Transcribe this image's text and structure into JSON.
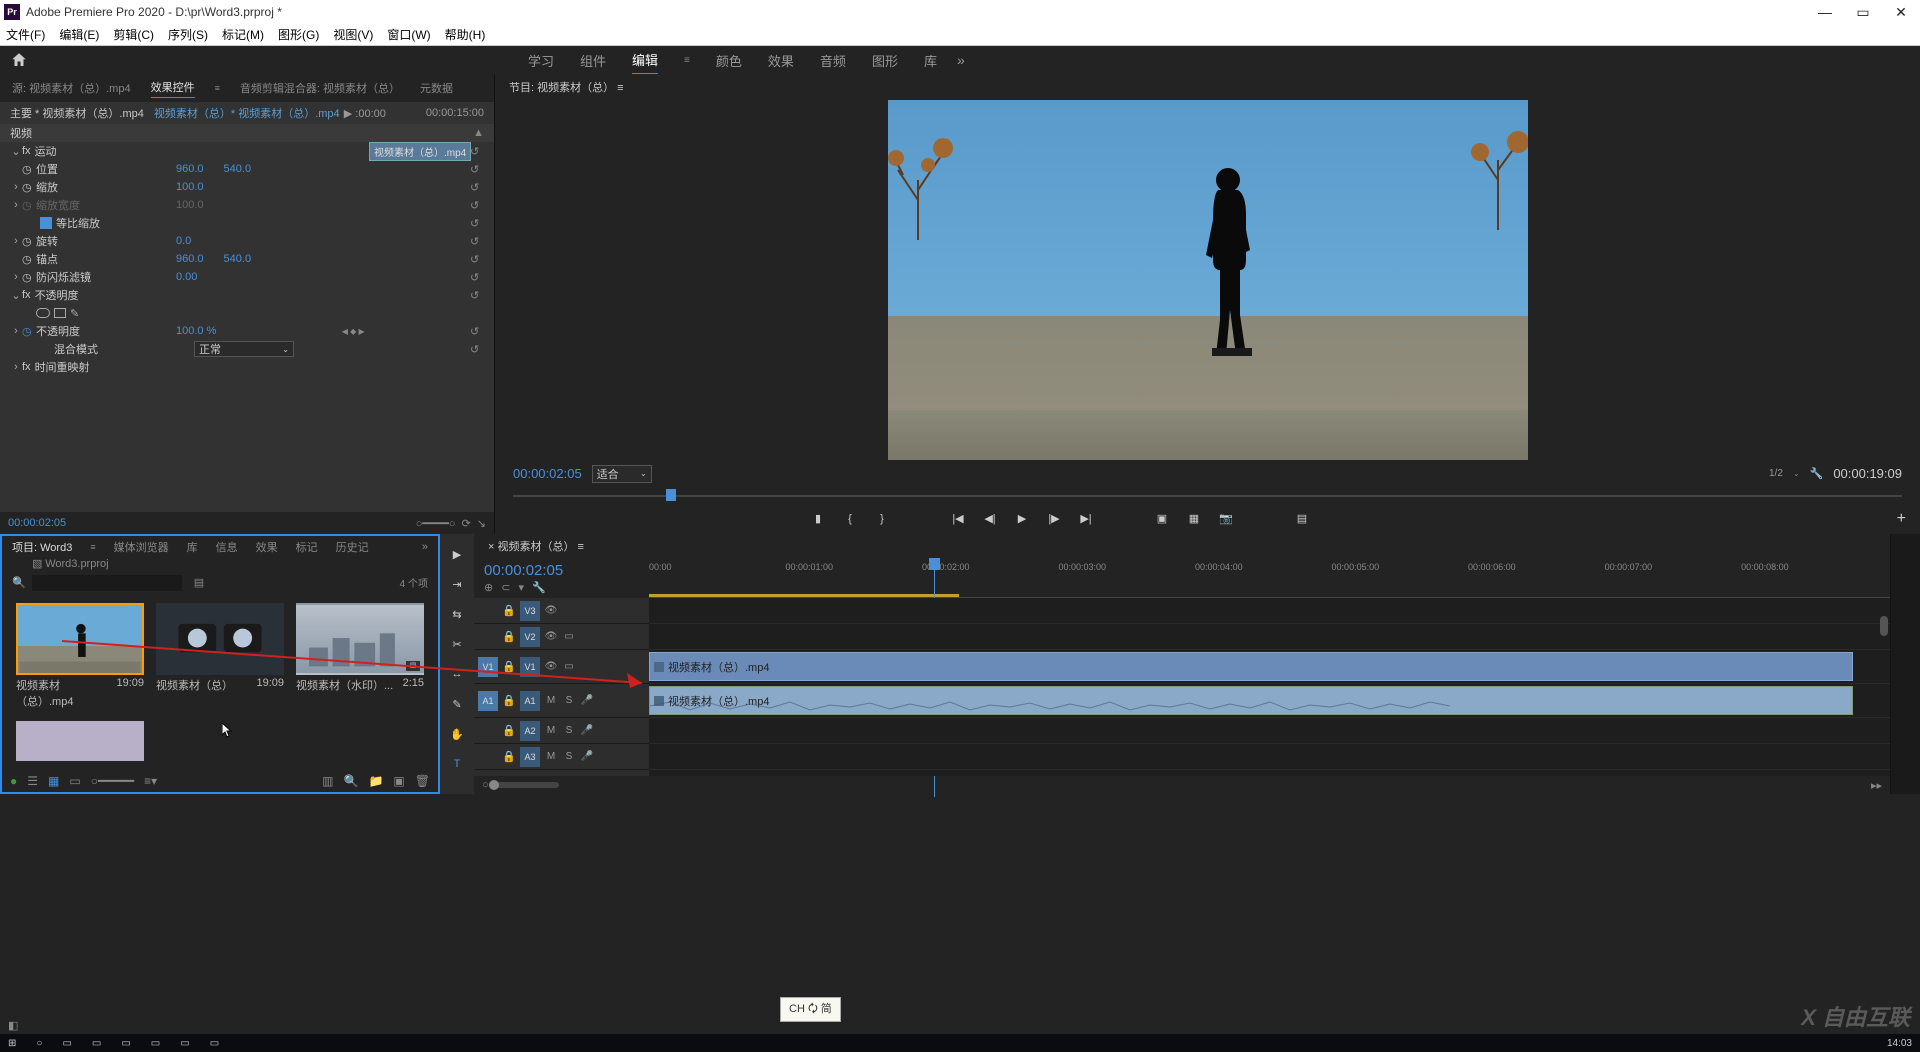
{
  "titlebar": {
    "app_icon": "Pr",
    "title": "Adobe Premiere Pro 2020 - D:\\pr\\Word3.prproj *"
  },
  "menubar": [
    "文件(F)",
    "编辑(E)",
    "剪辑(C)",
    "序列(S)",
    "标记(M)",
    "图形(G)",
    "视图(V)",
    "窗口(W)",
    "帮助(H)"
  ],
  "workspaces": {
    "items": [
      "学习",
      "组件",
      "编辑",
      "颜色",
      "效果",
      "音频",
      "图形",
      "库"
    ],
    "active": 2
  },
  "source_tabs": {
    "items": [
      "源: 视频素材（总）.mp4",
      "效果控件",
      "音频剪辑混合器: 视频素材（总）",
      "元数据"
    ],
    "active": 1
  },
  "fx": {
    "header_main": "主要 * 视频素材（总）.mp4",
    "header_seq": "视频素材（总）* 视频素材（总）.mp4",
    "timeline_start": "▶ :00:00",
    "timeline_end": "00:00:15:00",
    "clip_label": "视频素材（总）.mp4",
    "video_label": "视频",
    "groups": [
      {
        "name": "运动",
        "expanded": true
      },
      {
        "name": "不透明度",
        "expanded": true
      },
      {
        "name": "时间重映射",
        "expanded": false
      }
    ],
    "motion": {
      "position": {
        "label": "位置",
        "x": "960.0",
        "y": "540.0"
      },
      "scale": {
        "label": "缩放",
        "val": "100.0"
      },
      "scale_w": {
        "label": "缩放宽度",
        "val": "100.0"
      },
      "uniform": {
        "label": "等比缩放"
      },
      "rotation": {
        "label": "旋转",
        "val": "0.0"
      },
      "anchor": {
        "label": "锚点",
        "x": "960.0",
        "y": "540.0"
      },
      "antiflicker": {
        "label": "防闪烁滤镜",
        "val": "0.00"
      }
    },
    "opacity": {
      "label": "不透明度",
      "val": "100.0 %",
      "blend": {
        "label": "混合模式",
        "val": "正常"
      }
    },
    "timecode": "00:00:02:05"
  },
  "program": {
    "tab": "节目: 视频素材（总） ≡",
    "timecode": "00:00:02:05",
    "fit": "适合",
    "zoom": "1/2",
    "duration": "00:00:19:09"
  },
  "project": {
    "tabs": [
      "项目: Word3",
      "媒体浏览器",
      "库",
      "信息",
      "效果",
      "标记",
      "历史记"
    ],
    "active": 0,
    "file": "Word3.prproj",
    "count": "4 个项",
    "bins": [
      {
        "name": "视频素材（总）.mp4",
        "dur": "19:09",
        "sel": true,
        "bg": "#6aaad6"
      },
      {
        "name": "视频素材（总）",
        "dur": "19:09",
        "sel": false,
        "bg": "#2a3038"
      },
      {
        "name": "视频素材（水印）...",
        "dur": "2:15",
        "sel": false,
        "bg": "#8a98a8"
      }
    ]
  },
  "timeline": {
    "tab": "视频素材（总） ≡",
    "timecode": "00:00:02:05",
    "ticks": [
      "00:00",
      "00:00:01:00",
      "00:00:02:00",
      "00:00:03:00",
      "00:00:04:00",
      "00:00:05:00",
      "00:00:06:00",
      "00:00:07:00",
      "00:00:08:00"
    ],
    "video_tracks": [
      {
        "name": "V3",
        "src": ""
      },
      {
        "name": "V2",
        "src": ""
      },
      {
        "name": "V1",
        "src": "V1",
        "clip": "视频素材（总）.mp4"
      }
    ],
    "audio_tracks": [
      {
        "name": "A1",
        "src": "A1",
        "clip": "视频素材（总）.mp4"
      },
      {
        "name": "A2",
        "src": ""
      },
      {
        "name": "A3",
        "src": ""
      }
    ]
  },
  "ime": "CH 🗘 简",
  "watermark": "X 自由互联",
  "taskbar_time": "14:03"
}
